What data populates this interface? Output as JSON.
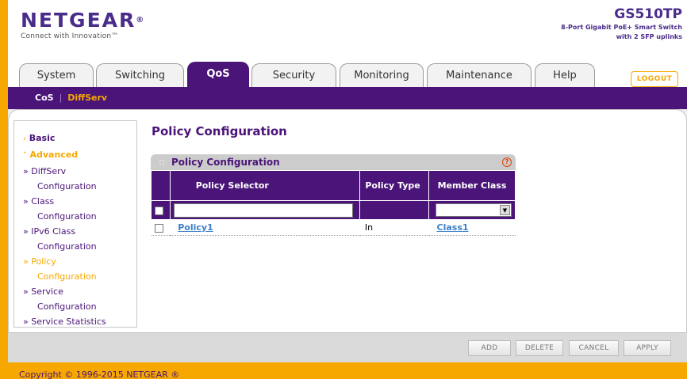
{
  "brand": {
    "logo": "NETGEAR",
    "registered": "®",
    "tagline": "Connect with Innovation™",
    "model": "GS510TP",
    "model_desc_line1": "8-Port Gigabit PoE+ Smart Switch",
    "model_desc_line2": "with 2 SFP uplinks"
  },
  "tabs": [
    {
      "label": "System"
    },
    {
      "label": "Switching"
    },
    {
      "label": "QoS"
    },
    {
      "label": "Security"
    },
    {
      "label": "Monitoring"
    },
    {
      "label": "Maintenance"
    },
    {
      "label": "Help"
    }
  ],
  "active_tab": "QoS",
  "logout_label": "LOGOUT",
  "subnav": {
    "cos": "CoS",
    "separator": "|",
    "diffserv": "DiffServ"
  },
  "sidebar": {
    "basic": "Basic",
    "advanced": "Advanced",
    "items": [
      {
        "line1": "» DiffServ",
        "line2": "Configuration"
      },
      {
        "line1": "» Class",
        "line2": "Configuration"
      },
      {
        "line1": "» IPv6 Class",
        "line2": "Configuration"
      },
      {
        "line1": "» Policy",
        "line2": "Configuration"
      },
      {
        "line1": "» Service",
        "line2": "Configuration"
      },
      {
        "line1": "» Service Statistics"
      }
    ]
  },
  "page_title": "Policy Configuration",
  "panel": {
    "title": "Policy Configuration",
    "help_icon": "?",
    "columns": [
      "Policy Selector",
      "Policy Type",
      "Member Class"
    ],
    "rows": [
      {
        "selector": "Policy1",
        "type": "In",
        "member_class": "Class1"
      }
    ]
  },
  "buttons": {
    "add": "ADD",
    "delete": "DELETE",
    "cancel": "CANCEL",
    "apply": "APPLY"
  },
  "footer": "Copyright © 1996-2015 NETGEAR ®",
  "colors": {
    "accent": "#4a1478",
    "orange": "#f7a800",
    "link": "#3c7fc8"
  }
}
